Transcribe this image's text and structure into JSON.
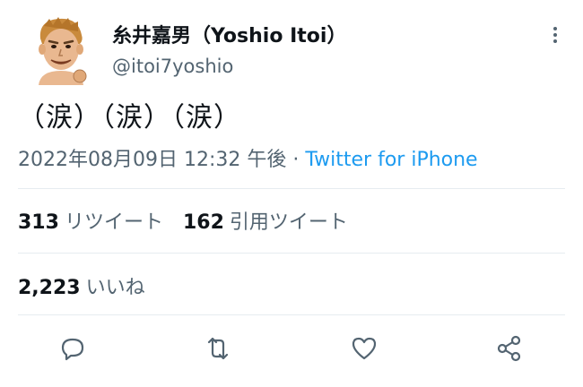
{
  "author": {
    "display_name": "糸井嘉男（Yoshio Itoi）",
    "handle": "@itoi7yoshio"
  },
  "tweet": {
    "text": "（涙）（涙）（涙）",
    "timestamp": "2022年08月09日 12:32 午後",
    "separator": " · ",
    "source": "Twitter for iPhone"
  },
  "stats": {
    "retweets_count": "313",
    "retweets_label": "リツイート",
    "quotes_count": "162",
    "quotes_label": "引用ツイート",
    "likes_count": "2,223",
    "likes_label": "いいね"
  },
  "icons": {
    "more": "more-vertical-icon",
    "reply": "reply-icon",
    "retweet": "retweet-icon",
    "like": "heart-icon",
    "share": "share-icon"
  },
  "colors": {
    "text": "#0f1419",
    "secondary": "#536471",
    "link": "#1d9bf0",
    "divider": "#e6ecf0"
  }
}
